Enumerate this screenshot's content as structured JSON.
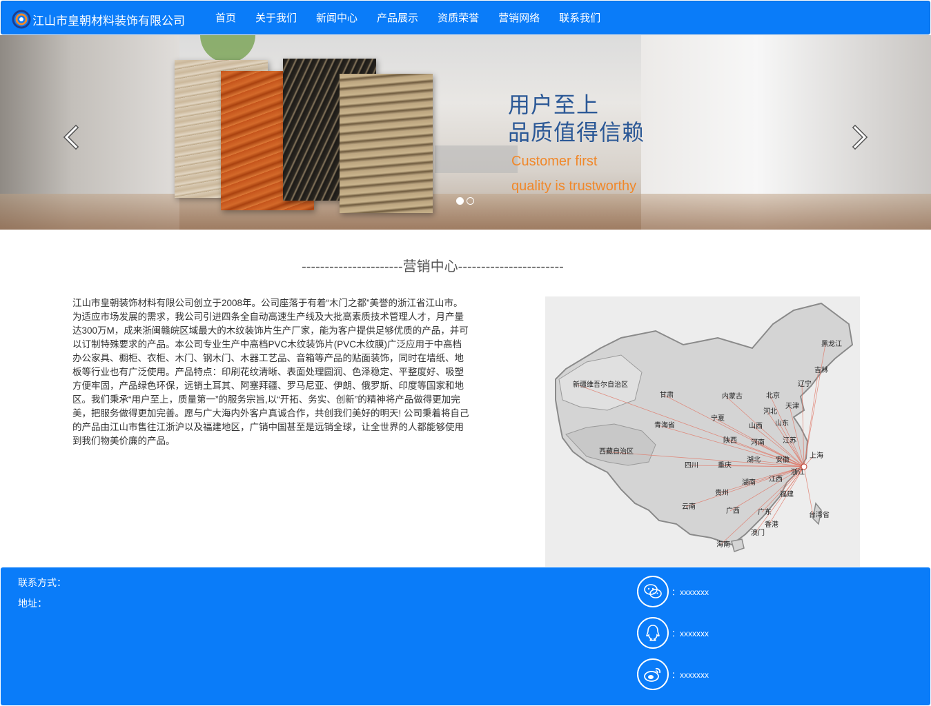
{
  "navbar": {
    "brand": "江山市皇朝材料装饰有限公司",
    "items": [
      "首页",
      "关于我们",
      "新闻中心",
      "产品展示",
      "资质荣誉",
      "营销网络",
      "联系我们"
    ]
  },
  "carousel": {
    "slogan_cn_1": "用户至上",
    "slogan_cn_2": "品质值得信赖",
    "slogan_en_1": "Customer first",
    "slogan_en_2": "quality is trustworthy",
    "slide_count": 2,
    "active_slide": 1
  },
  "section": {
    "title": "----------------------营销中心-----------------------",
    "intro": "江山市皇朝装饰材料有限公司创立于2008年。公司座落于有着“木门之都”美誉的浙江省江山市。为适应市场发展的需求，我公司引进四条全自动高速生产线及大批高素质技术管理人才，月产量达300万M，成来浙闽赣皖区域最大的木纹装饰片生产厂家，能为客户提供足够优质的产品，并可以订制特殊要求的产品。本公司专业生产中高档PVC木纹装饰片(PVC木纹膜)广泛应用于中高档办公家具、橱柜、衣柜、木门、钢木门、木器工艺品、音箱等产品的贴面装饰，同时在墙纸、地板等行业也有广泛使用。产品特点：印刷花纹清晰、表面处理圆润、色泽稳定、平整度好、吸塑方便牢固，产品绿色环保，远销土耳其、阿塞拜疆、罗马尼亚、伊朗、俄罗斯、印度等国家和地区。我们秉承“用户至上，质量第一”的服务宗旨,以“开拓、务实、创新”的精神将产品做得更加完美，把服务做得更加完善。愿与广大海内外客户真诚合作，共创我们美好的明天! 公司秉着将自己的产品由江山市售往江浙沪以及福建地区，广销中国甚至是远销全球，让全世界的人都能够使用到我们物美价廉的产品。"
  },
  "map": {
    "regions": [
      "黑龙江",
      "吉林",
      "辽宁",
      "新疆维吾尔自治区",
      "甘肃",
      "内蒙古",
      "北京",
      "天津",
      "河北",
      "宁夏",
      "山西",
      "山东",
      "青海省",
      "陕西",
      "河南",
      "江苏",
      "西藏自治区",
      "湖北",
      "安徽",
      "上海",
      "四川",
      "重庆",
      "浙江",
      "江西",
      "湖南",
      "福建",
      "贵州",
      "云南",
      "广西",
      "广东",
      "台湾省",
      "香港",
      "澳门",
      "海南"
    ],
    "hub": "浙江"
  },
  "footer": {
    "contact_label": "联系方式：",
    "address_label": "地址：",
    "wechat": "：xxxxxxx",
    "qq": "：xxxxxxx",
    "weibo": "：xxxxxxx"
  },
  "colors": {
    "primary": "#0a7cf9",
    "slogan_blue": "#2b5896",
    "slogan_orange": "#f0882a"
  }
}
